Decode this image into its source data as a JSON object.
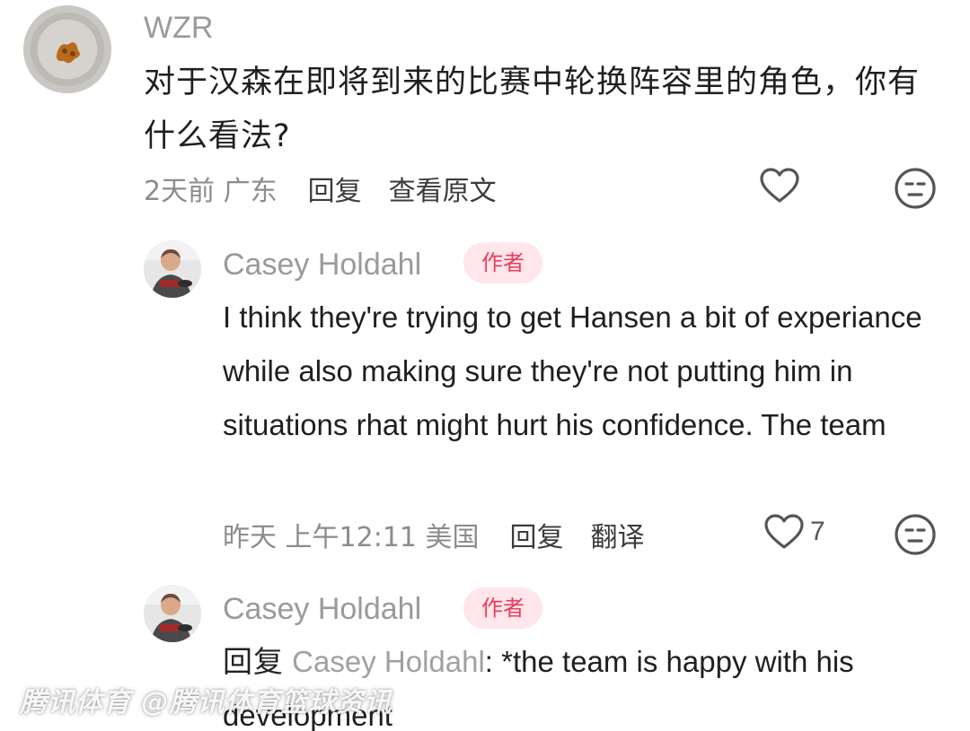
{
  "comment": {
    "username": "WZR",
    "avatar_icon": "nail-polish-photo-avatar",
    "text": "对于汉森在即将到来的比赛中轮换阵容里的角色，你有什么看法?",
    "time": "2天前",
    "location": "广东",
    "reply_label": "回复",
    "view_original_label": "查看原文",
    "like_icon": "heart-outline-icon",
    "dislike_icon": "neutral-face-icon"
  },
  "reply1": {
    "username": "Casey Holdahl",
    "badge": "作者",
    "text": "I think they're trying to get Hansen a bit of experiance while also making sure they're not putting him in situations rhat might hurt his confidence. The team",
    "time": "昨天 上午12:11",
    "location": "美国",
    "reply_label": "回复",
    "translate_label": "翻译",
    "like_count": "7",
    "like_icon": "heart-outline-icon",
    "dislike_icon": "neutral-face-icon"
  },
  "reply2": {
    "username": "Casey Holdahl",
    "badge": "作者",
    "prefix": "回复",
    "reply_to": "Casey Holdahl",
    "text": ": *the team is happy with his development"
  },
  "watermark": "腾讯体育 @腾讯体育篮球资讯",
  "colors": {
    "badge_bg": "#ffe6ea",
    "badge_text": "#ea3d5c",
    "username": "#9a9a9a"
  }
}
